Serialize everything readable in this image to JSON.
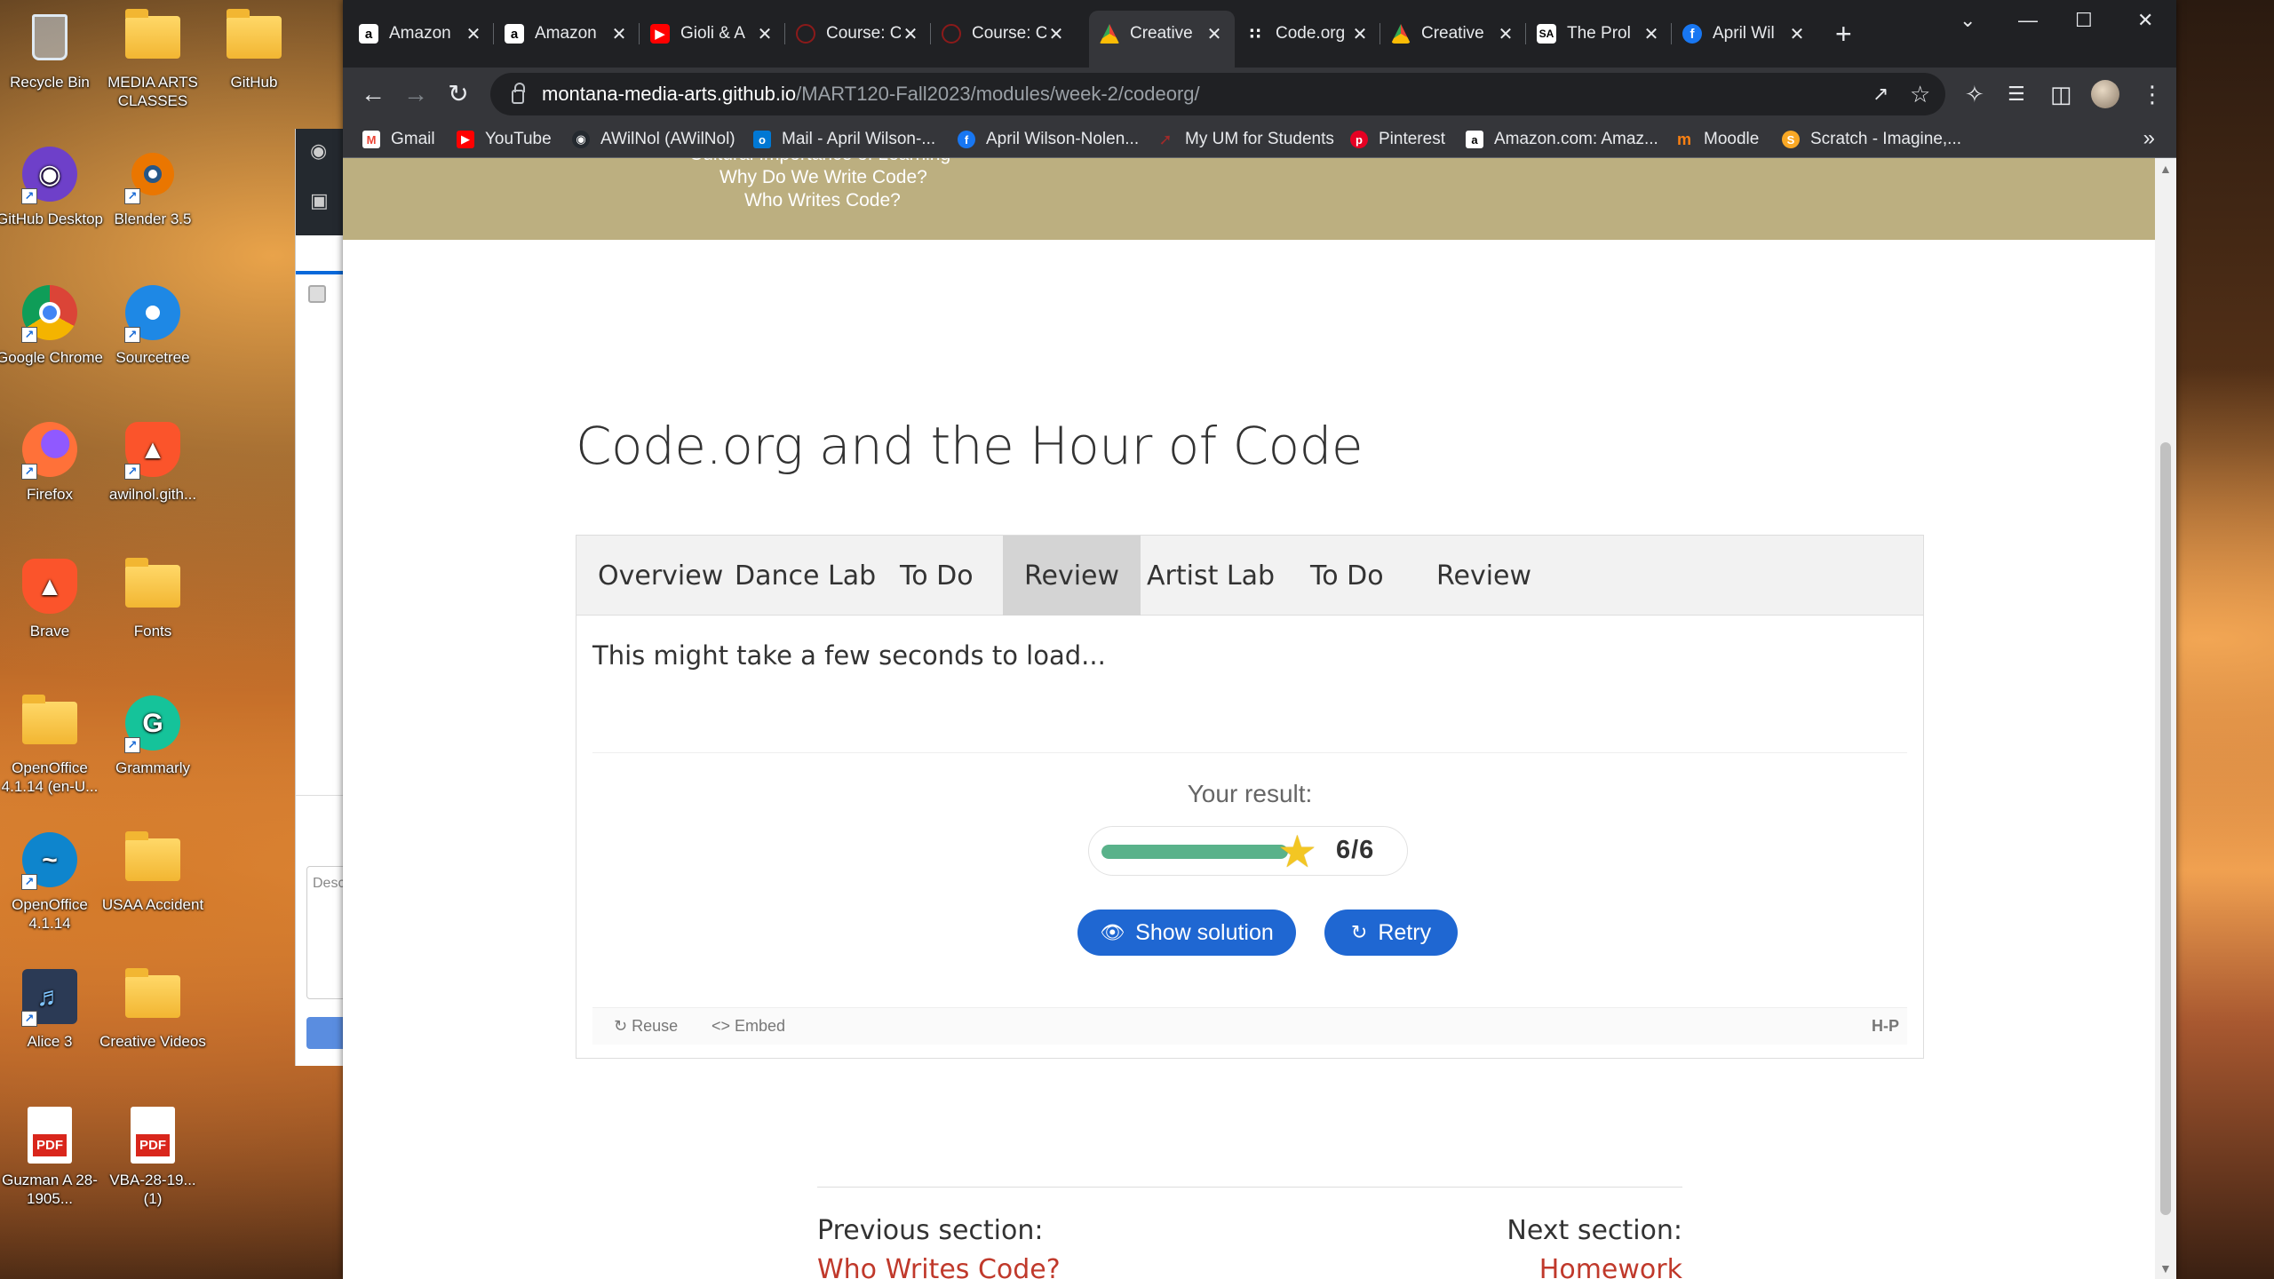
{
  "desktop": {
    "icons": [
      {
        "label": "Recycle Bin"
      },
      {
        "label": "MEDIA ARTS CLASSES"
      },
      {
        "label": "GitHub"
      },
      {
        "label": "GitHub Desktop"
      },
      {
        "label": "Blender 3.5"
      },
      {
        "label": "Google Chrome"
      },
      {
        "label": "Sourcetree"
      },
      {
        "label": "Firefox"
      },
      {
        "label": "awilnol.gith..."
      },
      {
        "label": "Brave"
      },
      {
        "label": "Fonts"
      },
      {
        "label": "OpenOffice 4.1.14 (en-U..."
      },
      {
        "label": "Grammarly"
      },
      {
        "label": "OpenOffice 4.1.14"
      },
      {
        "label": "USAA Accident"
      },
      {
        "label": "Alice 3"
      },
      {
        "label": "Creative Videos"
      },
      {
        "label": "Guzman A 28-1905..."
      },
      {
        "label": "VBA-28-19... (1)"
      }
    ],
    "pdf_badge": "PDF"
  },
  "background_app": {
    "description_placeholder": "Desc"
  },
  "browser": {
    "tabs": [
      {
        "title": "Amazon"
      },
      {
        "title": "Amazon"
      },
      {
        "title": "Gioli & A"
      },
      {
        "title": "Course: C"
      },
      {
        "title": "Course: C"
      },
      {
        "title": "Creative"
      },
      {
        "title": "Code.org"
      },
      {
        "title": "Creative"
      },
      {
        "title": "The Prol"
      },
      {
        "title": "April Wil"
      }
    ],
    "active_tab_index": 5,
    "url_host": "montana-media-arts.github.io",
    "url_path": "/MART120-Fall2023/modules/week-2/codeorg/",
    "bookmarks": [
      {
        "label": "Gmail"
      },
      {
        "label": "YouTube"
      },
      {
        "label": "AWilNol (AWilNol)"
      },
      {
        "label": "Mail - April Wilson-..."
      },
      {
        "label": "April Wilson-Nolen..."
      },
      {
        "label": "My UM for Students"
      },
      {
        "label": "Pinterest"
      },
      {
        "label": "Amazon.com: Amaz..."
      },
      {
        "label": "Moodle"
      },
      {
        "label": "Scratch - Imagine,..."
      }
    ]
  },
  "page": {
    "banner_links": [
      "Cultural Importance of Learning",
      "Why Do We Write Code?",
      "Who Writes Code?"
    ],
    "title": "Code.org and the Hour of Code",
    "h5p_tabs": [
      "Overview",
      "Dance Lab",
      "To Do",
      "Review",
      "Artist Lab",
      "To Do",
      "Review"
    ],
    "active_h5p_tab": 3,
    "loading_text": "This might take a few seconds to load...",
    "quiz": {
      "result_label": "Your result:",
      "score": "6/6",
      "score_fraction": 1.0,
      "show_solution_label": "Show solution",
      "retry_label": "Retry",
      "footer_reuse": "Reuse",
      "footer_embed": "Embed",
      "footer_brand": "H-P"
    },
    "prev_section_label": "Previous section:",
    "prev_section_link": "Who Writes Code?",
    "next_section_label": "Next section:",
    "next_section_link": "Homework"
  },
  "colors": {
    "banner": "#bcaf80",
    "accent_button": "#1f67d2",
    "score_fill": "#59b28a",
    "star": "#f3c623",
    "link": "#c0392b"
  }
}
